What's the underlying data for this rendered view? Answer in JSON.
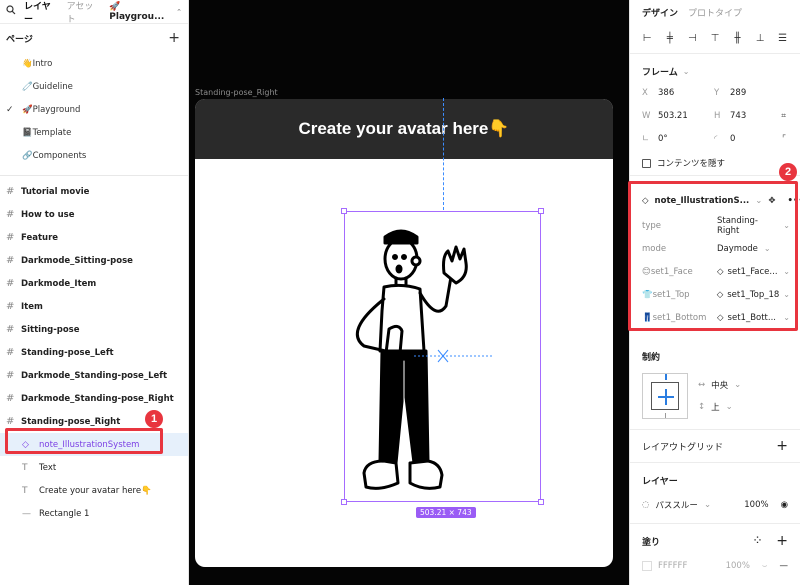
{
  "left_panel": {
    "tabs": [
      "レイヤー",
      "アセット"
    ],
    "file_name": "🚀Playgrou...",
    "pages_title": "ページ",
    "pages": [
      {
        "label": "👋Intro",
        "current": false
      },
      {
        "label": "🧷Guideline",
        "current": false
      },
      {
        "label": "🚀Playground",
        "current": true
      },
      {
        "label": "📓Template",
        "current": false
      },
      {
        "label": "🔗Components",
        "current": false
      }
    ],
    "frames": [
      "Tutorial movie",
      "How to use",
      "Feature",
      "Darkmode_Sitting-pose",
      "Darkmode_Item",
      "Item",
      "Sitting-pose",
      "Standing-pose_Left",
      "Darkmode_Standing-pose_Left",
      "Darkmode_Standing-pose_Right",
      "Standing-pose_Right"
    ],
    "children": [
      {
        "icon": "◇",
        "label": "note_IllustrationSystem",
        "selected": true
      },
      {
        "icon": "T",
        "label": "Text",
        "selected": false
      },
      {
        "icon": "T",
        "label": "Create your avatar here👇",
        "selected": false
      },
      {
        "icon": "—",
        "label": "Rectangle 1",
        "selected": false
      }
    ]
  },
  "annotations": {
    "badge1": "1",
    "badge2": "2"
  },
  "canvas": {
    "frame_label": "Standing-pose_Right",
    "header_text": "Create your avatar here👇",
    "dimension_label": "503.21 × 743"
  },
  "right_panel": {
    "tabs": [
      "デザイン",
      "プロトタイプ"
    ],
    "frame_section": {
      "title": "フレーム",
      "x": "386",
      "y": "289",
      "w": "503.21",
      "h": "743",
      "rotation": "0°",
      "radius": "0"
    },
    "hide_contents_label": "コンテンツを隠す",
    "component": {
      "name": "note_IllustrationS...",
      "props": [
        {
          "key": "type",
          "value": "Standing-Right",
          "instance": false
        },
        {
          "key": "mode",
          "value": "Daymode",
          "instance": false
        },
        {
          "key": "😊set1_Face",
          "value": "set1_Face...",
          "instance": true
        },
        {
          "key": "👕set1_Top",
          "value": "set1_Top_18",
          "instance": true
        },
        {
          "key": "👖set1_Bottom",
          "value": "set1_Bott...",
          "instance": true
        }
      ]
    },
    "constraints": {
      "title": "制約",
      "horizontal": "中央",
      "vertical": "上"
    },
    "layout_grid_title": "レイアウトグリッド",
    "layer_section": {
      "title": "レイヤー",
      "blend": "パススルー",
      "opacity": "100%"
    },
    "fill_section": {
      "title": "塗り",
      "hex": "FFFFFF",
      "opacity": "100%"
    }
  }
}
